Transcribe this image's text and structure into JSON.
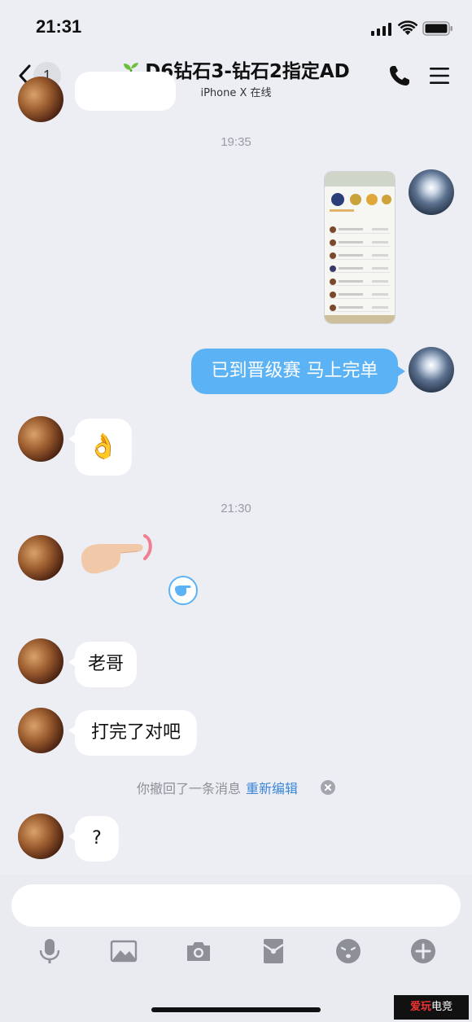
{
  "status_bar": {
    "time": "21:31"
  },
  "header": {
    "unread_count": "1",
    "title": "D6钻石3-钻石2指定AD",
    "subtitle": "iPhone X 在线"
  },
  "messages": {
    "ts1": "19:35",
    "mine_text": "已到晋级赛 马上完单",
    "ok_emoji": "👌",
    "ts2": "21:30",
    "laoge": "老哥",
    "dawan": "打完了对吧",
    "recall_text": "你撤回了一条消息",
    "recall_link": "重新编辑",
    "question": "?"
  },
  "composer": {
    "placeholder": ""
  },
  "watermark": {
    "left": "爱玩",
    "right": "电竞"
  }
}
